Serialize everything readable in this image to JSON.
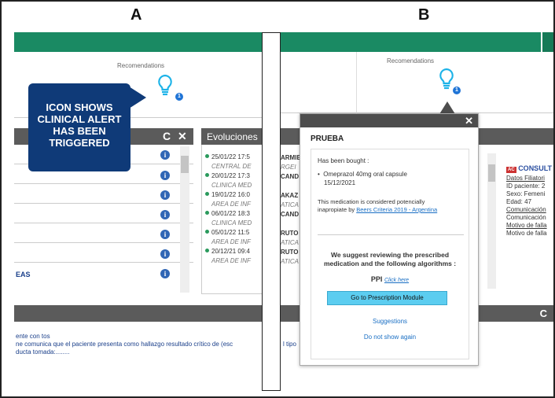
{
  "labels": {
    "a": "A",
    "b": "B"
  },
  "recommendations": {
    "a_label": "Recomendations",
    "b_label": "Recomendations",
    "a_badge": "1",
    "b_badge": "1"
  },
  "callout": {
    "line1": "ICON SHOWS",
    "line2": "CLINICAL ALERT",
    "line3": "HAS BEEN",
    "line4": "TRIGGERED"
  },
  "left_panel": {
    "last_item": "EAS",
    "refresh_glyph": "C",
    "close_glyph": "✕"
  },
  "evoluciones": {
    "title": "Evoluciones",
    "entries": [
      {
        "date": "25/01/22 17:5",
        "name": "ARMIE",
        "sub": "CENTRAL DE",
        "sub2": "RGEI"
      },
      {
        "date": "20/01/22 17:3",
        "name": "CAND",
        "sub": "CLINICA MED",
        "sub2": ""
      },
      {
        "date": "19/01/22 16:0",
        "name": "AKAZ",
        "sub": "AREA DE INF",
        "sub2": "ATICA"
      },
      {
        "date": "06/01/22 18:3",
        "name": "CAND",
        "sub": "CLINICA MED",
        "sub2": ""
      },
      {
        "date": "05/01/22 11:5",
        "name": "RUTO",
        "sub": "AREA DE INF",
        "sub2": "ATICA"
      },
      {
        "date": "20/12/21 09:4",
        "name": "RUTO",
        "sub": "AREA DE INF",
        "sub2": "ATICA"
      }
    ]
  },
  "popup": {
    "title": "PRUEBA",
    "bought_label": "Has been bought :",
    "med_line1": "Omeprazol 40mg oral capsule",
    "med_line2": "15/12/2021",
    "note_line1": "This medication is considered potencially",
    "note_line2_prefix": "inapropiate by",
    "note_link": "Beers Criteria 2019 - Argentina",
    "suggest_line1": "We suggest reviewing the prescribed",
    "suggest_line2": "medication and the following algorithms :",
    "algo": "PPI",
    "algo_link": "Click here",
    "button": "Go to Prescription Module",
    "suggestions_link": "Suggestions",
    "dismiss_link": "Do not show again",
    "close_glyph": "✕"
  },
  "patient_card": {
    "ac_badge": "AC",
    "title": "CONSULT",
    "lines": [
      "Datos Filiatori",
      "ID paciente: 2",
      "Sexo: Femeni",
      "Edad: 47",
      "Comunicación",
      "Comunicación",
      "Motivo de falla",
      "Motivo de falla"
    ]
  },
  "bottom_text": {
    "line1": "ente con tos",
    "line2": "ne comunica que el paciente presenta como hallazgo resultado crítico de (esc",
    "line2b": "l tipo",
    "line3": "ducta tomada:........",
    "refresh_glyph": "C"
  },
  "colors": {
    "green_bar": "#1a8a63",
    "callout": "#0f3a78",
    "button": "#5ccdf0",
    "badge": "#1f74d6"
  }
}
